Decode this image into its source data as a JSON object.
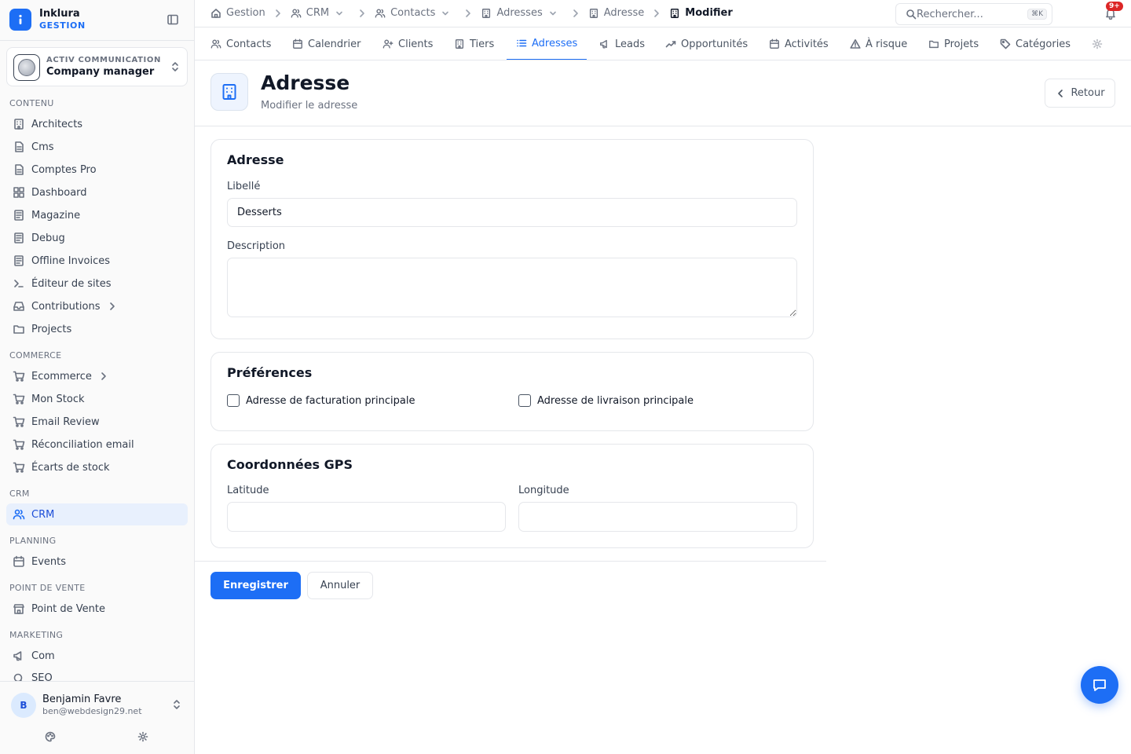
{
  "brand": {
    "name": "Inklura",
    "sub": "GESTION"
  },
  "org": {
    "label": "ACTIV COMMUNICATION",
    "name": "Company manager"
  },
  "sidebar": {
    "sections": [
      {
        "title": "CONTENU",
        "items": [
          {
            "label": "Architects",
            "icon": "building-icon"
          },
          {
            "label": "Cms",
            "icon": "file-icon"
          },
          {
            "label": "Comptes Pro",
            "icon": "file-icon"
          },
          {
            "label": "Dashboard",
            "icon": "grid-icon"
          },
          {
            "label": "Magazine",
            "icon": "newspaper-icon"
          },
          {
            "label": "Debug",
            "icon": "newspaper-icon"
          },
          {
            "label": "Offline Invoices",
            "icon": "newspaper-icon"
          },
          {
            "label": "Éditeur de sites",
            "icon": "terminal-icon"
          },
          {
            "label": "Contributions",
            "icon": "inbox-icon",
            "has_children": true
          },
          {
            "label": "Projects",
            "icon": "folder-icon"
          }
        ]
      },
      {
        "title": "COMMERCE",
        "items": [
          {
            "label": "Ecommerce",
            "icon": "cart-icon",
            "has_children": true
          },
          {
            "label": "Mon Stock",
            "icon": "cart-icon"
          },
          {
            "label": "Email Review",
            "icon": "cart-icon"
          },
          {
            "label": "Réconciliation email",
            "icon": "cart-icon"
          },
          {
            "label": "Écarts de stock",
            "icon": "cart-icon"
          }
        ]
      },
      {
        "title": "CRM",
        "items": [
          {
            "label": "CRM",
            "icon": "users-icon",
            "active": true
          }
        ]
      },
      {
        "title": "PLANNING",
        "items": [
          {
            "label": "Events",
            "icon": "calendar-icon"
          }
        ]
      },
      {
        "title": "POINT DE VENTE",
        "items": [
          {
            "label": "Point de Vente",
            "icon": "store-icon"
          }
        ]
      },
      {
        "title": "MARKETING",
        "items": [
          {
            "label": "Com",
            "icon": "megaphone-icon"
          },
          {
            "label": "SEO",
            "icon": "search-icon"
          }
        ]
      }
    ]
  },
  "user": {
    "initial": "B",
    "name": "Benjamin Favre",
    "email": "ben@webdesign29.net"
  },
  "breadcrumb": [
    {
      "label": "Gestion",
      "icon": "home-icon"
    },
    {
      "label": "CRM",
      "icon": "users-icon",
      "dropdown": true
    },
    {
      "label": "Contacts",
      "icon": "users-icon",
      "dropdown": true
    },
    {
      "label": "Adresses",
      "icon": "building-icon",
      "dropdown": true
    },
    {
      "label": "Adresse",
      "icon": "building-icon"
    },
    {
      "label": "Modifier",
      "icon": "building-icon",
      "current": true
    }
  ],
  "search": {
    "placeholder": "Rechercher...",
    "shortcut": "⌘K"
  },
  "notifications": {
    "badge": "9+"
  },
  "tabs": [
    {
      "label": "Contacts",
      "icon": "users-icon"
    },
    {
      "label": "Calendrier",
      "icon": "calendar-icon"
    },
    {
      "label": "Clients",
      "icon": "user-plus-icon"
    },
    {
      "label": "Tiers",
      "icon": "building-icon"
    },
    {
      "label": "Adresses",
      "icon": "list-icon",
      "active": true
    },
    {
      "label": "Leads",
      "icon": "megaphone-icon"
    },
    {
      "label": "Opportunités",
      "icon": "trend-icon"
    },
    {
      "label": "Activités",
      "icon": "calendar-icon"
    },
    {
      "label": "À risque",
      "icon": "warning-icon"
    },
    {
      "label": "Projets",
      "icon": "folder-icon"
    },
    {
      "label": "Catégories",
      "icon": "tag-icon"
    }
  ],
  "header": {
    "title": "Adresse",
    "subtitle": "Modifier le adresse",
    "back_label": "Retour"
  },
  "form": {
    "address_section": {
      "title": "Adresse",
      "libelle_label": "Libellé",
      "libelle_value": "Desserts",
      "description_label": "Description",
      "description_value": ""
    },
    "preferences": {
      "title": "Préférences",
      "billing_label": "Adresse de facturation principale",
      "billing_checked": false,
      "shipping_label": "Adresse de livraison principale",
      "shipping_checked": false
    },
    "gps": {
      "title": "Coordonnées GPS",
      "latitude_label": "Latitude",
      "latitude_value": "",
      "longitude_label": "Longitude",
      "longitude_value": ""
    },
    "save_label": "Enregistrer",
    "cancel_label": "Annuler"
  },
  "colors": {
    "accent": "#1d6ef5",
    "badge": "#dc2626",
    "active_bg": "#e8f0fd"
  }
}
